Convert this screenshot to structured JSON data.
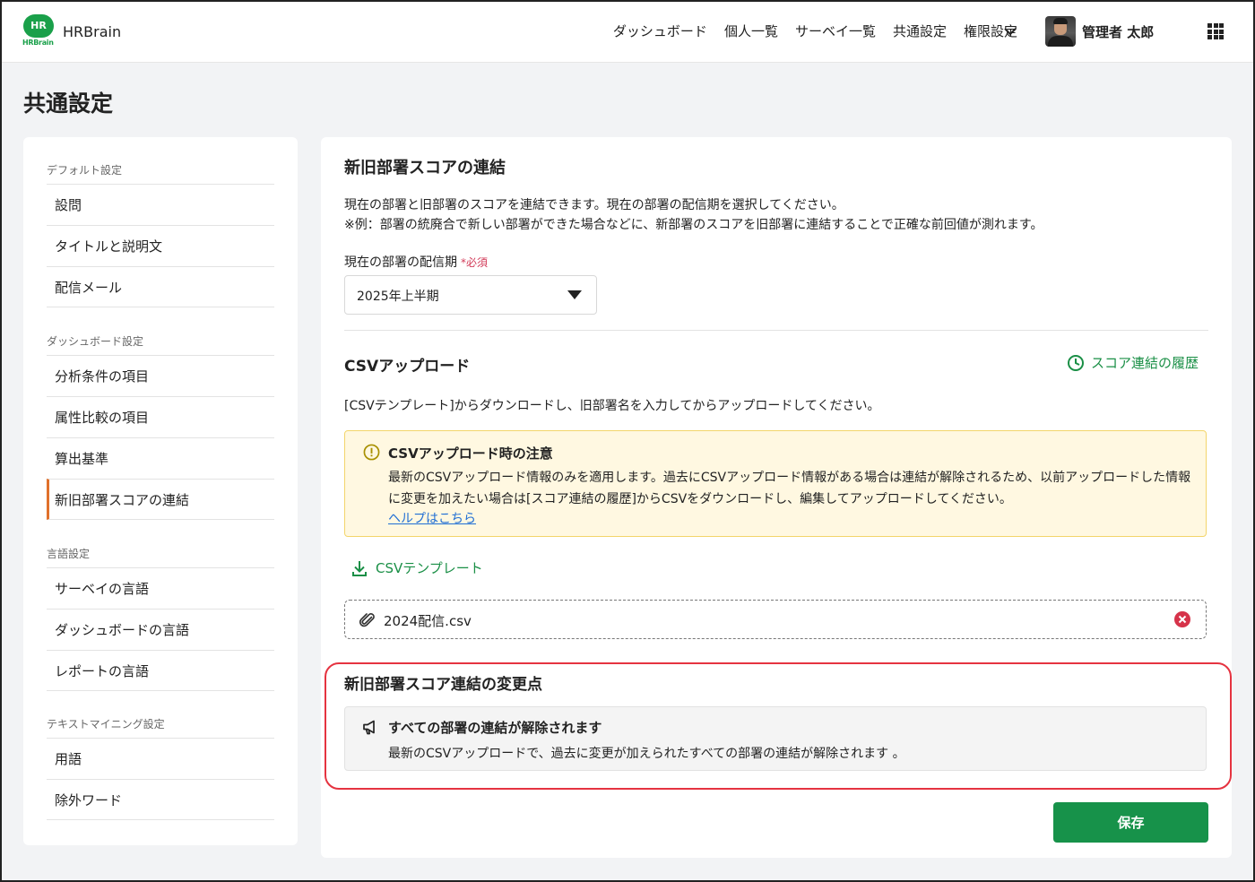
{
  "header": {
    "logo_text": "HR",
    "logo_sub": "HRBrain",
    "brand": "HRBrain",
    "nav": [
      "ダッシュボード",
      "個人一覧",
      "サーベイ一覧",
      "共通設定",
      "権限設定"
    ],
    "user_name": "管理者 太郎"
  },
  "page": {
    "title": "共通設定"
  },
  "sidebar": {
    "sections": [
      {
        "title": "デフォルト設定",
        "items": [
          "設問",
          "タイトルと説明文",
          "配信メール"
        ]
      },
      {
        "title": "ダッシュボード設定",
        "items": [
          "分析条件の項目",
          "属性比較の項目",
          "算出基準",
          "新旧部署スコアの連結"
        ]
      },
      {
        "title": "言語設定",
        "items": [
          "サーベイの言語",
          "ダッシュボードの言語",
          "レポートの言語"
        ]
      },
      {
        "title": "テキストマイニング設定",
        "items": [
          "用語",
          "除外ワード"
        ]
      }
    ],
    "active_item": "新旧部署スコアの連結"
  },
  "main": {
    "title": "新旧部署スコアの連結",
    "desc1": "現在の部署と旧部署のスコアを連結できます。現在の部署の配信期を選択してください。",
    "desc2": "※例：部署の統廃合で新しい部署ができた場合などに、新部署のスコアを旧部署に連結することで正確な前回値が測れます。",
    "period_label": "現在の部署の配信期",
    "required": "*必須",
    "period_value": "2025年上半期",
    "csv": {
      "title": "CSVアップロード",
      "history_link": "スコア連結の履歴",
      "desc": "[CSVテンプレート]からダウンロードし、旧部署名を入力してからアップロードしてください。",
      "warning_title": "CSVアップロード時の注意",
      "warning_body": "最新のCSVアップロード情報のみを適用します。過去にCSVアップロード情報がある場合は連結が解除されるため、以前アップロードした情報に変更を加えたい場合は[スコア連結の履歴]からCSVをダウンロードし、編集してアップロードしてください。",
      "help_link": "ヘルプはこちら",
      "template_link": "CSVテンプレート",
      "file_name": "2024配信.csv"
    },
    "changes": {
      "title": "新旧部署スコア連結の変更点",
      "notice_title": "すべての部署の連結が解除されます",
      "notice_body": "最新のCSVアップロードで、過去に変更が加えられたすべての部署の連結が解除されます 。"
    },
    "save_label": "保存"
  },
  "colors": {
    "accent_green": "#17924a",
    "active_orange": "#e0702b",
    "highlight_red": "#e53340",
    "warning_bg": "#fff8e1"
  }
}
